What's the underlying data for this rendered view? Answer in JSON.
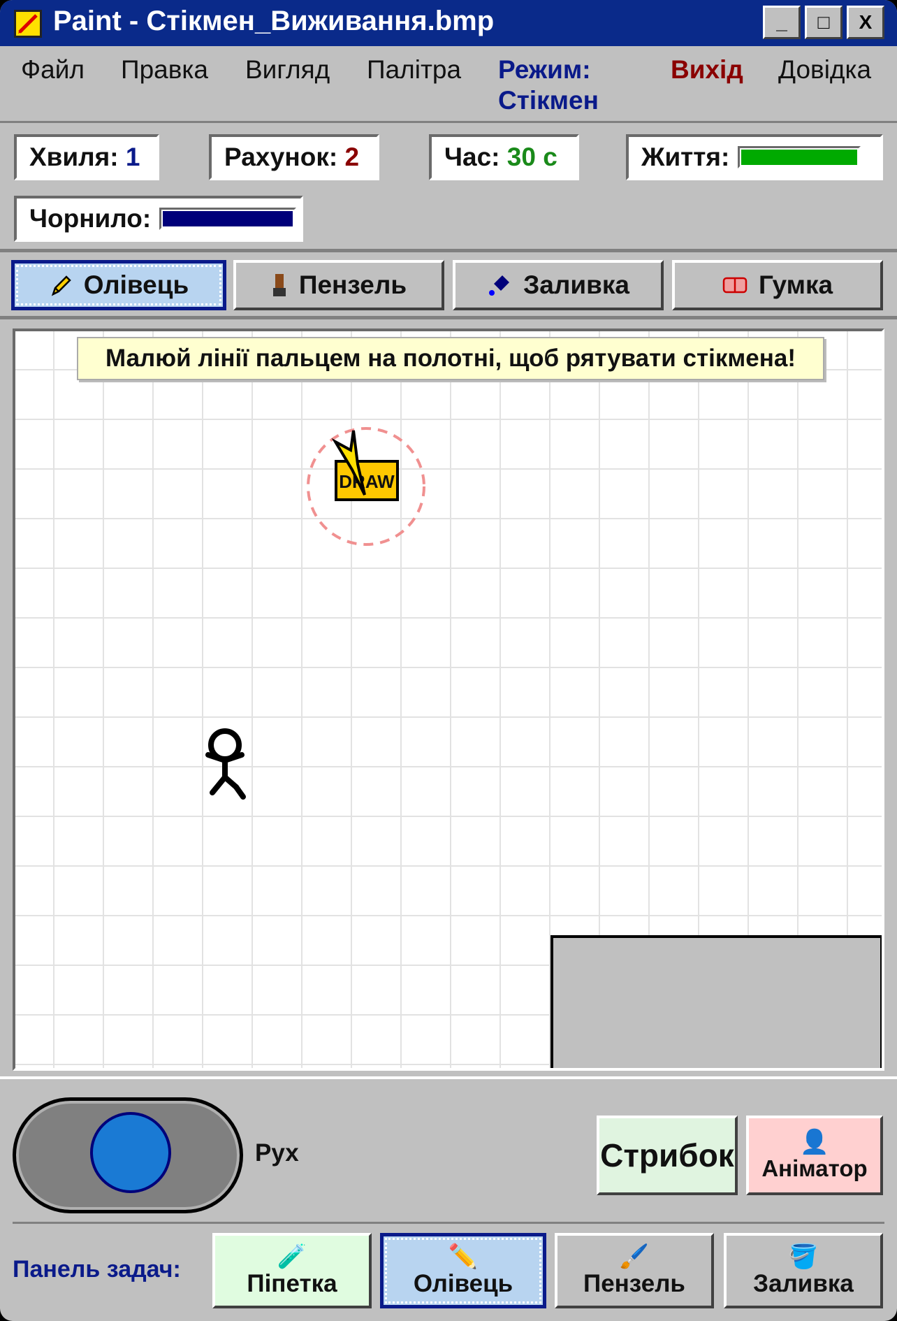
{
  "window": {
    "title": "Paint - Стікмен_Виживання.bmp",
    "minimize_label": "_",
    "maximize_label": "□",
    "close_label": "X"
  },
  "menu": {
    "file": "Файл",
    "edit": "Правка",
    "view": "Вигляд",
    "palette": "Палітра",
    "mode_label": "Режим:",
    "mode_value": "Стікмен",
    "exit": "Вихід",
    "help": "Довідка"
  },
  "stats": {
    "wave_label": "Хвиля:",
    "wave_value": "1",
    "score_label": "Рахунок:",
    "score_value": "2",
    "time_label": "Час:",
    "time_value": "30 с",
    "life_label": "Життя:",
    "life_level": 1.0,
    "ink_label": "Чорнило:",
    "ink_level": 1.0
  },
  "tools": {
    "pencil": "Олівець",
    "brush": "Пензель",
    "fill": "Заливка",
    "eraser": "Гумка",
    "active": "pencil"
  },
  "canvas": {
    "tip": "Малюй лінії пальцем на полотні, щоб рятувати стікмена!",
    "powerup_text": "DRAW"
  },
  "controls": {
    "move_label": "Рух",
    "jump_label": "Стрибок",
    "animator_label": "Аніматор",
    "animator_icon": "👤"
  },
  "taskbar": {
    "label": "Панель задач:",
    "items": [
      {
        "label": "Піпетка",
        "icon": "🧪"
      },
      {
        "label": "Олівець",
        "icon": "✏️"
      },
      {
        "label": "Пензель",
        "icon": "🖌️"
      },
      {
        "label": "Заливка",
        "icon": "🪣"
      }
    ],
    "active_index": 1
  },
  "colors": {
    "titlebar": "#0a2a8a",
    "score": "#8a0000",
    "time": "#1a8a1a",
    "wave": "#0a1a8a",
    "life_fill": "#00aa00",
    "ink_fill": "#00007a"
  }
}
